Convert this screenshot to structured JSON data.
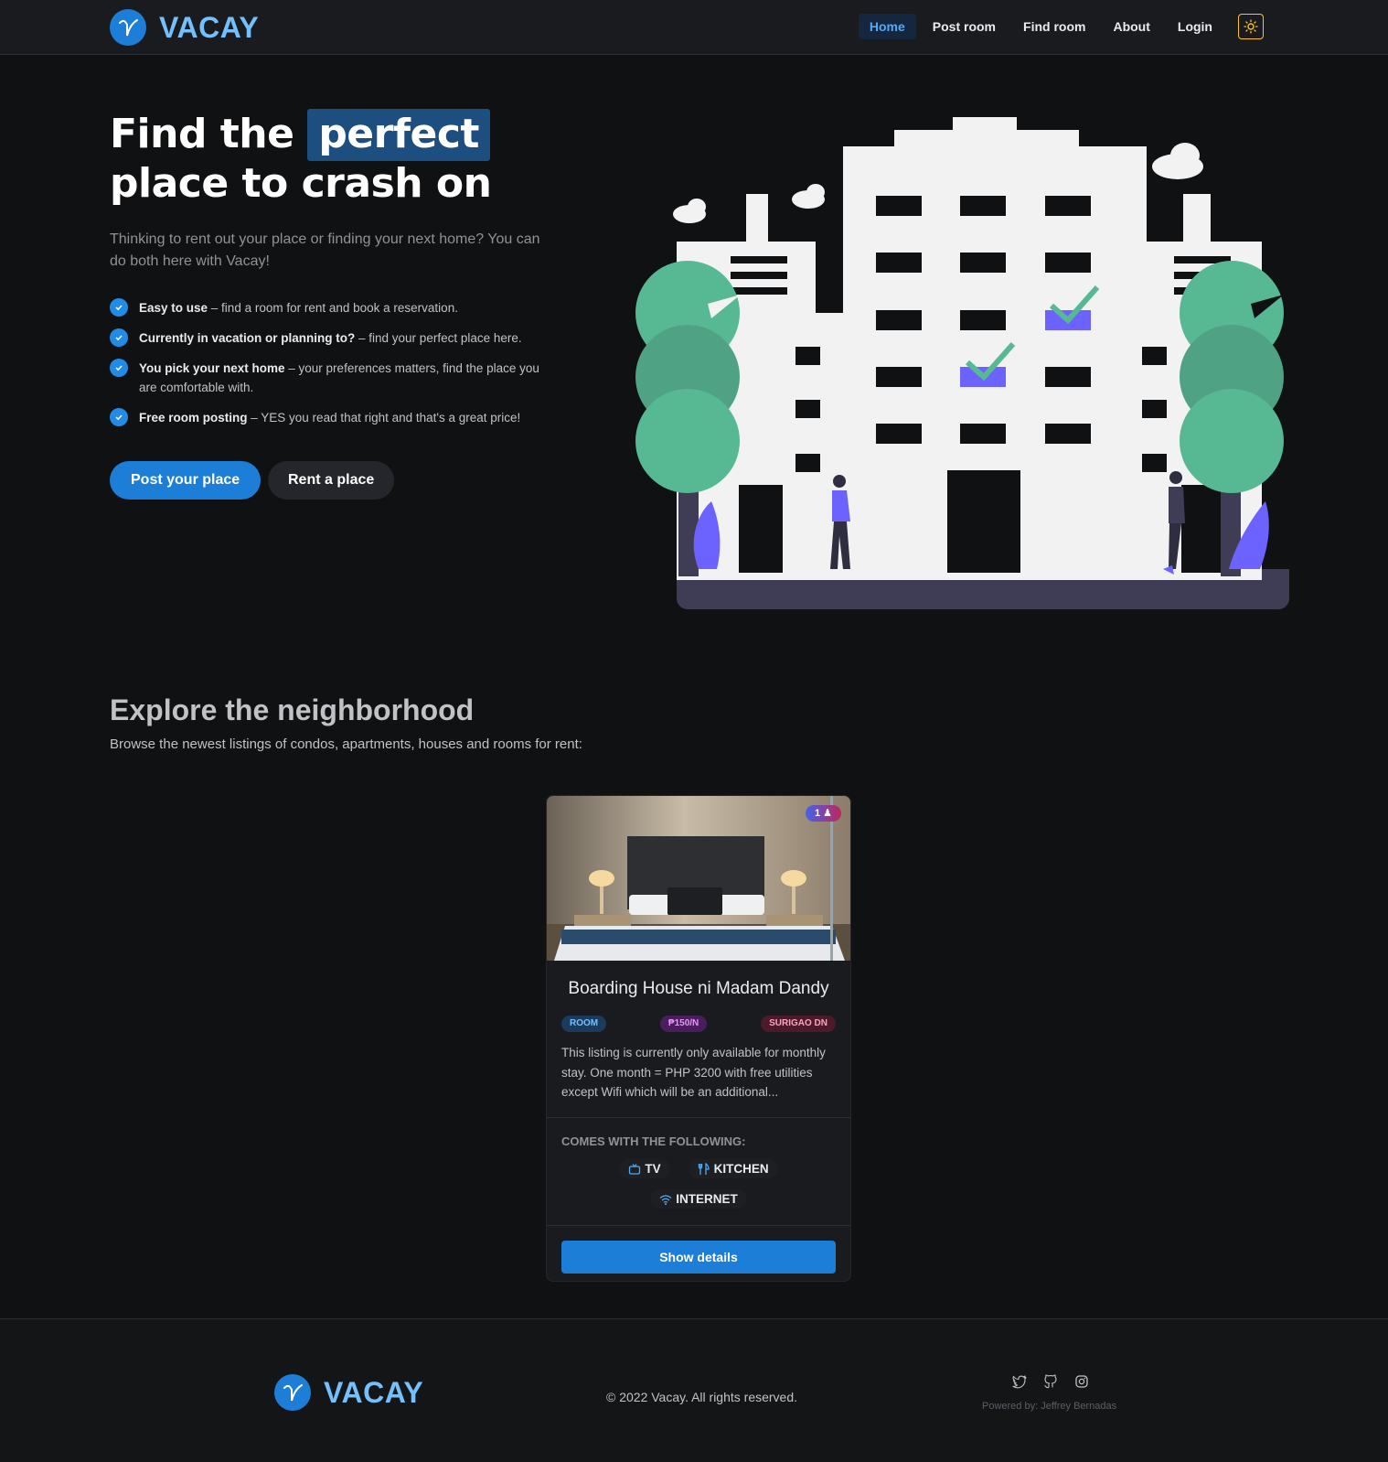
{
  "brand": {
    "name": "VACAY",
    "accent": "#1c7ed6"
  },
  "nav": {
    "items": [
      {
        "label": "Home",
        "active": true
      },
      {
        "label": "Post room",
        "active": false
      },
      {
        "label": "Find room",
        "active": false
      },
      {
        "label": "About",
        "active": false
      },
      {
        "label": "Login",
        "active": false
      }
    ],
    "theme_icon": "sun-icon"
  },
  "hero": {
    "title_part1": "Find the",
    "title_highlight": "perfect",
    "title_part2": "place to crash on",
    "subtitle": "Thinking to rent out your place or finding your next home? You can do both here with Vacay!",
    "features": [
      {
        "bold": "Easy to use",
        "text": " – find a room for rent and book a reservation."
      },
      {
        "bold": "Currently in vacation or planning to?",
        "text": " – find your perfect place here."
      },
      {
        "bold": "You pick your next home",
        "text": " – your preferences matters, find the place you are comfortable with."
      },
      {
        "bold": "Free room posting",
        "text": " – YES you read that right and that's a great price!"
      }
    ],
    "post_button": "Post your place",
    "rent_button": "Rent a place"
  },
  "explore": {
    "title": "Explore the neighborhood",
    "subtitle": "Browse the newest listings of condos, apartments, houses and rooms for rent:"
  },
  "listing": {
    "occupancy": "1",
    "title": "Boarding House ni Madam Dandy",
    "badges": [
      "ROOM",
      "₱150/N",
      "SURIGAO DN"
    ],
    "description": "This listing is currently only available for monthly stay. One month = PHP 3200 with free utilities except Wifi which will be an additional...",
    "comes_label": "COMES WITH THE FOLLOWING:",
    "amenities": [
      {
        "icon": "tv-icon",
        "label": "TV"
      },
      {
        "icon": "utensils-icon",
        "label": "KITCHEN"
      },
      {
        "icon": "wifi-icon",
        "label": "INTERNET"
      }
    ],
    "button": "Show details"
  },
  "footer": {
    "brand": "VACAY",
    "copyright": "© 2022 Vacay. All rights reserved.",
    "powered": "Powered by: Jeffrey Bernadas",
    "socials": [
      "twitter-icon",
      "github-icon",
      "instagram-icon"
    ]
  }
}
